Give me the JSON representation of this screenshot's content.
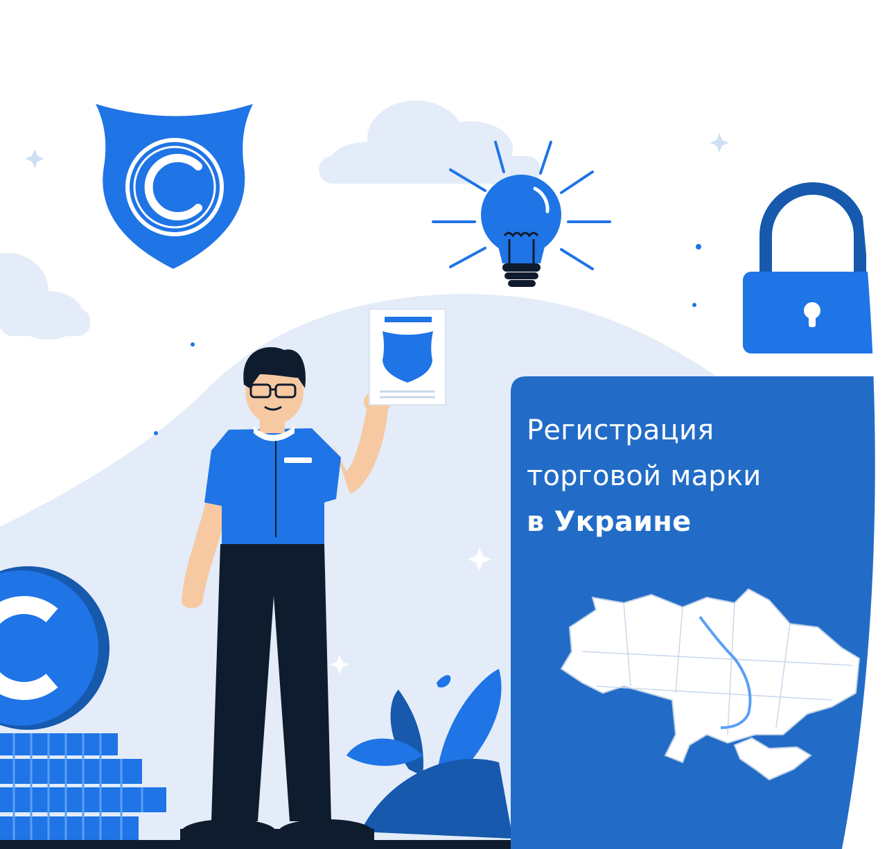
{
  "banner": {
    "line1": "Регистрация",
    "line2": "торговой марки",
    "line3": "в Украине"
  },
  "colors": {
    "primary_blue": "#1f74e6",
    "panel_blue": "#226cc7",
    "light_blue_bg": "#e3ecf8",
    "dark_navy": "#0f1c2e",
    "skin": "#f7c9a2"
  },
  "icons": [
    "copyright-shield-icon",
    "lightbulb-icon",
    "padlock-icon",
    "copyright-coin-icon",
    "certificate-icon",
    "ukraine-map"
  ]
}
